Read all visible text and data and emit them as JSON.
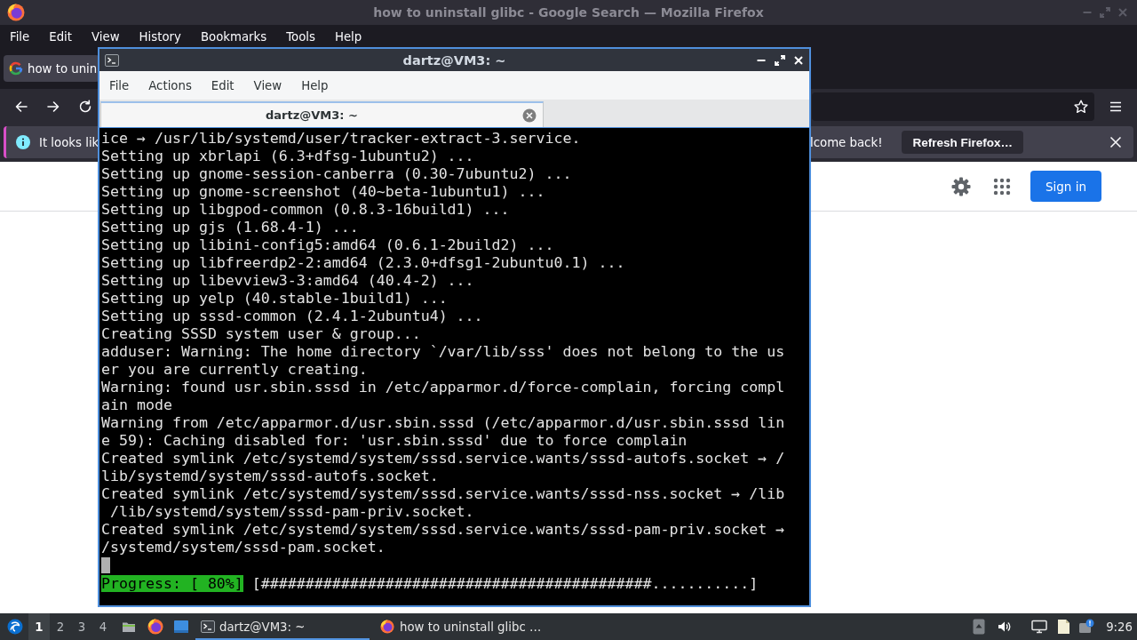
{
  "browser": {
    "title": "how to uninstall glibc - Google Search — Mozilla Firefox",
    "menu": [
      "File",
      "Edit",
      "View",
      "History",
      "Bookmarks",
      "Tools",
      "Help"
    ],
    "tabs": [
      {
        "label": "how to unin",
        "selected": true
      }
    ],
    "notification": {
      "text_left": "It looks lik",
      "text_right": "lcome back!",
      "button": "Refresh Firefox…"
    },
    "page": {
      "sign_in": "Sign in"
    }
  },
  "terminal": {
    "title": "dartz@VM3: ~",
    "menu": [
      "File",
      "Actions",
      "Edit",
      "View",
      "Help"
    ],
    "tabs": [
      {
        "label": "dartz@VM3: ~",
        "selected": true
      }
    ],
    "lines": [
      "ice → /usr/lib/systemd/user/tracker-extract-3.service.",
      "Setting up xbrlapi (6.3+dfsg-1ubuntu2) ...",
      "Setting up gnome-session-canberra (0.30-7ubuntu2) ...",
      "Setting up gnome-screenshot (40~beta-1ubuntu1) ...",
      "Setting up libgpod-common (0.8.3-16build1) ...",
      "Setting up gjs (1.68.4-1) ...",
      "Setting up libini-config5:amd64 (0.6.1-2build2) ...",
      "Setting up libfreerdp2-2:amd64 (2.3.0+dfsg1-2ubuntu0.1) ...",
      "Setting up libevview3-3:amd64 (40.4-2) ...",
      "Setting up yelp (40.stable-1build1) ...",
      "Setting up sssd-common (2.4.1-2ubuntu4) ...",
      "Creating SSSD system user & group...",
      "adduser: Warning: The home directory `/var/lib/sss' does not belong to the us",
      "er you are currently creating.",
      "Warning: found usr.sbin.sssd in /etc/apparmor.d/force-complain, forcing compl",
      "ain mode",
      "Warning from /etc/apparmor.d/usr.sbin.sssd (/etc/apparmor.d/usr.sbin.sssd lin",
      "e 59): Caching disabled for: 'usr.sbin.sssd' due to force complain",
      "Created symlink /etc/systemd/system/sssd.service.wants/sssd-autofs.socket → /",
      "lib/systemd/system/sssd-autofs.socket.",
      "Created symlink /etc/systemd/system/sssd.service.wants/sssd-nss.socket → /lib",
      " /lib/systemd/system/sssd-pam-priv.socket.",
      "Created symlink /etc/systemd/system/sssd.service.wants/sssd-pam-priv.socket →",
      "/systemd/system/sssd-pam.socket."
    ],
    "progress": {
      "label": "Progress: [ 80%]",
      "bar": "[############################################...........]"
    }
  },
  "taskbar": {
    "workspaces": [
      {
        "label": "1",
        "selected": true
      },
      {
        "label": "2",
        "selected": false
      },
      {
        "label": "3",
        "selected": false
      },
      {
        "label": "4",
        "selected": false
      }
    ],
    "tasks": [
      {
        "kind": "terminal",
        "label": "dartz@VM3: ~",
        "selected": true
      },
      {
        "kind": "browser",
        "label": "how to uninstall glibc …",
        "selected": false
      }
    ],
    "clock": "9:26"
  }
}
